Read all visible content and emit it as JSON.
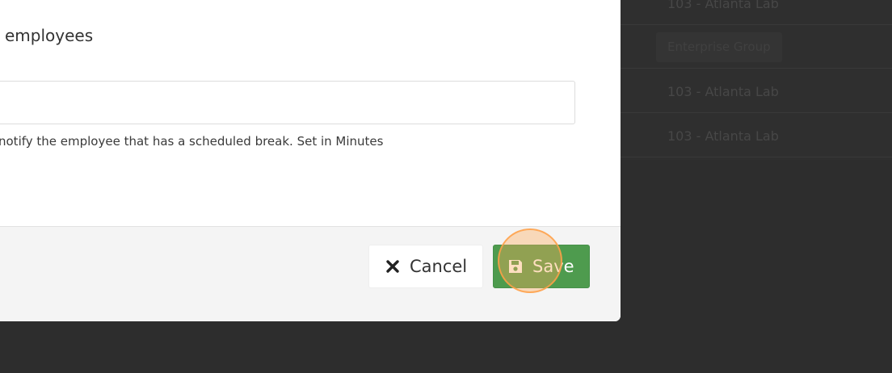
{
  "background_table": {
    "rows": [
      {
        "text": "103 - Atlanta Lab"
      },
      {
        "badge": "Enterprise Group"
      },
      {
        "text": "103 - Atlanta Lab"
      },
      {
        "text": "103 - Atlanta Lab"
      }
    ]
  },
  "modal": {
    "field_label": "employees",
    "minutes_input": {
      "value": "",
      "placeholder": ""
    },
    "help_text": "notify the employee that has a scheduled break. Set in Minutes",
    "footer": {
      "cancel_label": "Cancel",
      "save_label": "Save"
    }
  },
  "colors": {
    "save_green": "#4e9b4e",
    "overlay_dark": "#2d2d2d",
    "click_highlight": "#ffaa5a"
  },
  "icons": {
    "cancel": "close-icon",
    "save": "floppy-disk-icon"
  }
}
